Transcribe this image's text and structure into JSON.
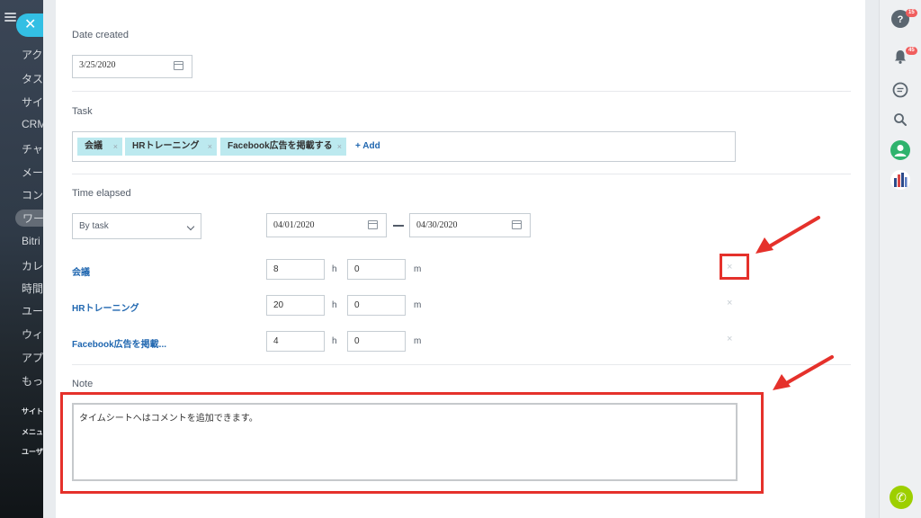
{
  "left_nav": {
    "close_symbol": "✕",
    "items": [
      "アク",
      "タス",
      "サイ",
      "CRM",
      "チャ",
      "メー",
      "コン",
      "ワー",
      "Bitri",
      "カレ",
      "時間",
      "ユー",
      "ウィ",
      "アプ",
      "もっ"
    ],
    "small_items": [
      "サイト",
      "メニュ",
      "ユーザ"
    ]
  },
  "form": {
    "date_created": {
      "label": "Date created",
      "value": "3/25/2020"
    },
    "task": {
      "label": "Task",
      "tags": [
        "会議",
        "HRトレーニング",
        "Facebook広告を掲載する"
      ],
      "tag_remove_symbol": "×",
      "add_label": "+ Add"
    },
    "time_elapsed": {
      "label": "Time elapsed",
      "mode": "By task",
      "date_from": "04/01/2020",
      "date_to": "04/30/2020",
      "unit_h": "h",
      "unit_m": "m",
      "remove_symbol": "×",
      "rows": [
        {
          "task": "会議",
          "hours": "8",
          "minutes": "0"
        },
        {
          "task": "HRトレーニング",
          "hours": "20",
          "minutes": "0"
        },
        {
          "task": "Facebook広告を掲載...",
          "hours": "4",
          "minutes": "0"
        }
      ]
    },
    "note": {
      "label": "Note",
      "value": "タイムシートへはコメントを追加できます。"
    }
  },
  "right_sidebar": {
    "help_badge": "15",
    "notifications_badge": "45",
    "call_symbol": "✆"
  },
  "colors": {
    "accent_blue": "#2067b0",
    "tag_bg": "#bce9ef",
    "annotation_red": "#e5312b",
    "close_button": "#33bfe4",
    "call_button": "#9dcf00",
    "badge_red": "#f05e5e"
  },
  "icons": [
    "menu-icon",
    "close-icon",
    "calendar-icon",
    "chevron-down-icon",
    "remove-icon",
    "help-icon",
    "bell-icon",
    "chat-icon",
    "search-icon",
    "user-avatar-icon",
    "company-logo-icon",
    "phone-icon",
    "annotation-arrow"
  ]
}
